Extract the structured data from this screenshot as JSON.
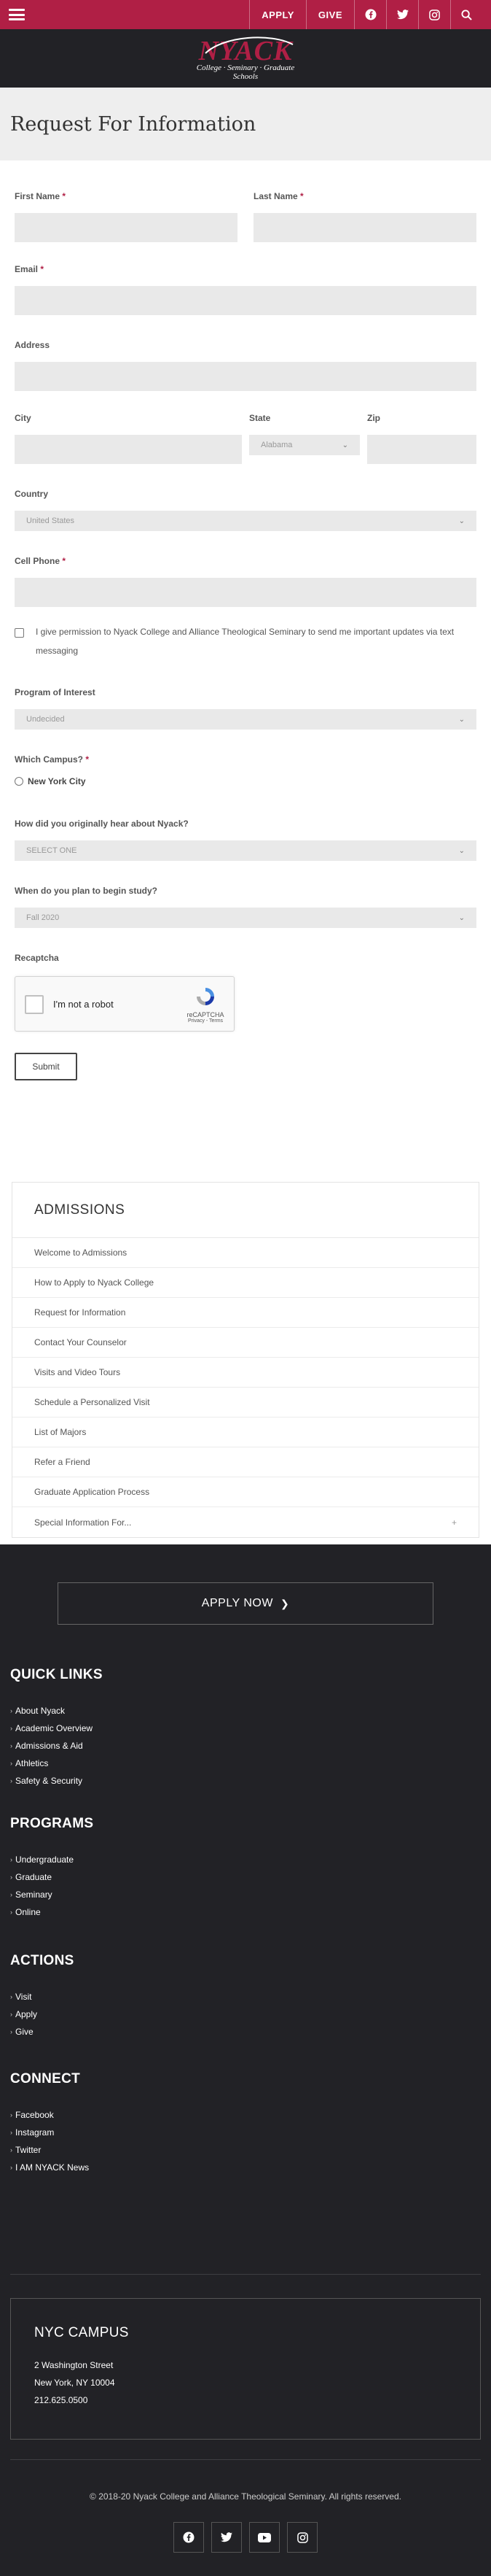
{
  "topbar": {
    "apply_label": "APPLY",
    "give_label": "GIVE",
    "icons": [
      "facebook-icon",
      "twitter-icon",
      "instagram-icon",
      "search-icon"
    ],
    "color": "#b01f45"
  },
  "logo": {
    "main": "NYACK",
    "sub": "College · Seminary · Graduate Schools"
  },
  "page": {
    "title": "Request For Information"
  },
  "form": {
    "first_name_label": "First Name",
    "last_name_label": "Last Name",
    "email_label": "Email",
    "address_label": "Address",
    "city_label": "City",
    "state_label": "State",
    "state_value": "Alabama",
    "zip_label": "Zip",
    "country_label": "Country",
    "country_value": "United States",
    "cell_phone_label": "Cell Phone",
    "permission_text": "I give permission to Nyack College and Alliance Theological Seminary to send me important updates via text messaging",
    "program_label": "Program of Interest",
    "program_value": "Undecided",
    "campus_label": "Which Campus?",
    "campus_option": "New York City",
    "hear_label": "How did you originally hear about Nyack?",
    "hear_value": "SELECT ONE",
    "begin_label": "When do you plan to begin study?",
    "begin_value": "Fall 2020",
    "recaptcha_label": "Recaptcha",
    "recaptcha_text": "I'm not a robot",
    "recaptcha_brand": "reCAPTCHA",
    "recaptcha_links": "Privacy - Terms",
    "submit_label": "Submit",
    "required_mark": "*"
  },
  "admissions": {
    "title": "ADMISSIONS",
    "items": [
      "Welcome to Admissions",
      "How to Apply to Nyack College",
      "Request for Information",
      "Contact Your Counselor",
      "Visits and Video Tours",
      "Schedule a Personalized Visit",
      "List of Majors",
      "Refer a Friend",
      "Graduate Application Process",
      "Special Information For..."
    ],
    "expand_marker": "+"
  },
  "footer": {
    "apply_now_label": "APPLY NOW",
    "quick_links_title": "QUICK LINKS",
    "quick_links": [
      "About Nyack",
      "Academic Overview",
      "Admissions & Aid",
      "Athletics",
      "Safety & Security"
    ],
    "programs_title": "PROGRAMS",
    "programs": [
      "Undergraduate",
      "Graduate",
      "Seminary",
      "Online"
    ],
    "actions_title": "ACTIONS",
    "actions": [
      "Visit",
      "Apply",
      "Give"
    ],
    "connect_title": "CONNECT",
    "connect": [
      "Facebook",
      "Instagram",
      "Twitter",
      "I AM NYACK News"
    ],
    "nyc_title": "NYC CAMPUS",
    "nyc_address1": "2 Washington Street",
    "nyc_address2": "New York, NY 10004",
    "nyc_phone": "212.625.0500",
    "copyright": "© 2018-20 Nyack College and Alliance Theological Seminary. All rights reserved.",
    "socials": [
      "facebook-icon",
      "twitter-icon",
      "youtube-icon",
      "instagram-icon"
    ]
  }
}
